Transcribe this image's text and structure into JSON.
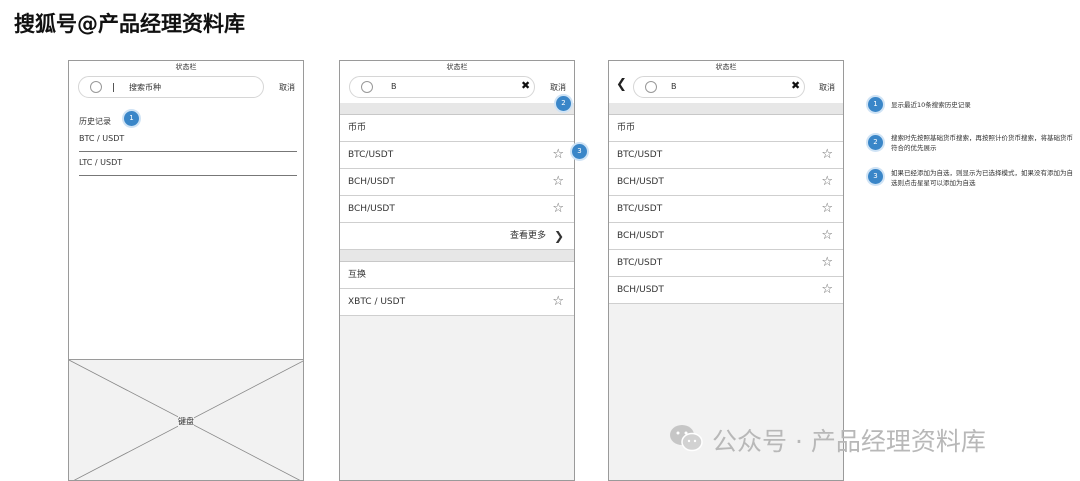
{
  "watermark_top": "搜狐号@产品经理资料库",
  "watermark_bottom": "公众号 · 产品经理资料库",
  "screen1": {
    "statusbar": "状态栏",
    "search_placeholder": "搜索币种",
    "cancel": "取消",
    "history_label": "历史记录",
    "history": [
      "BTC / USDT",
      "LTC / USDT"
    ],
    "keyboard_label": "键盘"
  },
  "screen2": {
    "statusbar": "状态栏",
    "search_value": "B",
    "cancel": "取消",
    "section1": "币币",
    "rows1": [
      "BTC/USDT",
      "BCH/USDT",
      "BCH/USDT"
    ],
    "more": "查看更多",
    "section2": "互换",
    "rows2": [
      "XBTC / USDT"
    ]
  },
  "screen3": {
    "statusbar": "状态栏",
    "search_value": "B",
    "cancel": "取消",
    "section1": "币币",
    "rows": [
      "BTC/USDT",
      "BCH/USDT",
      "BTC/USDT",
      "BCH/USDT",
      "BTC/USDT",
      "BCH/USDT"
    ]
  },
  "badges": [
    "1",
    "2",
    "3"
  ],
  "notes": [
    "显示最近10条搜索历史记录",
    "搜索时先按照基础货币搜索，再按照计价货币搜索，将基础货币符合的优先展示",
    "如果已经添加为自选，则显示为已选择模式，如果没有添加为自选则点击星星可以添加为自选"
  ],
  "icons": {
    "star": "☆",
    "clear": "✖",
    "back": "❮",
    "chevron": "❯"
  },
  "colors": {
    "badge": "#3a86c8"
  }
}
